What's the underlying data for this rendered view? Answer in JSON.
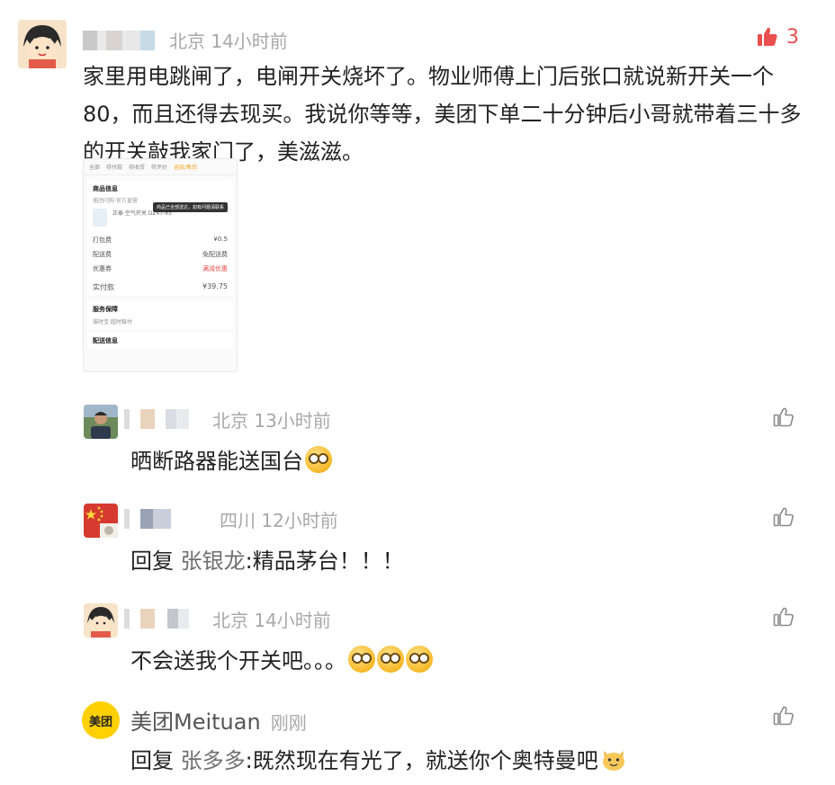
{
  "main_comment": {
    "location": "北京",
    "time": "14小时前",
    "like_count": "3",
    "text": "家里用电跳闸了，电闸开关烧坏了。物业师傅上门后张口就说新开关一个80，而且还得去现买。我说你等等，美团下单二十分钟后小哥就带着三十多的开关敲我家门了，美滋滋。",
    "screenshot": {
      "tabs": [
        "全部",
        "待付款",
        "待收货",
        "待评价",
        "退款/售后"
      ],
      "title": "商品信息",
      "store_line": "美团闪购·官方直营",
      "product_name": "正泰 空气开关 DZ47-63",
      "tooltip": "商品已全部送达，如有问题请联系",
      "fee_rows": [
        {
          "label": "打包费",
          "value": "¥0.5"
        },
        {
          "label": "配送费",
          "value": "免配送费"
        },
        {
          "label": "优惠券",
          "value": "满减优惠"
        }
      ],
      "paid_label": "实付款",
      "paid_value": "¥39.75",
      "service_title": "服务保障",
      "service_line": "准时宝·超时赔付",
      "delivery_title": "配送信息"
    }
  },
  "replies": [
    {
      "location": "北京",
      "time": "13小时前",
      "text": "晒断路器能送国台",
      "emoji_count": 1
    },
    {
      "location": "四川",
      "time": "12小时前",
      "reply_prefix": "回复",
      "reply_to": "张银龙",
      "text": ":精品茅台！！！"
    },
    {
      "location": "北京",
      "time": "14小时前",
      "text": "不会送我个开关吧。。。",
      "emoji_count": 3
    },
    {
      "name": "美团Meituan",
      "time": "刚刚",
      "logo_text": "美团",
      "reply_prefix": "回复",
      "reply_to": "张多多",
      "text": ":既然现在有光了，就送你个奥特曼吧"
    }
  ],
  "colors": {
    "like_active": "#e94f4f",
    "meta_gray": "#a8a8a8",
    "meituan_yellow": "#ffd000"
  }
}
